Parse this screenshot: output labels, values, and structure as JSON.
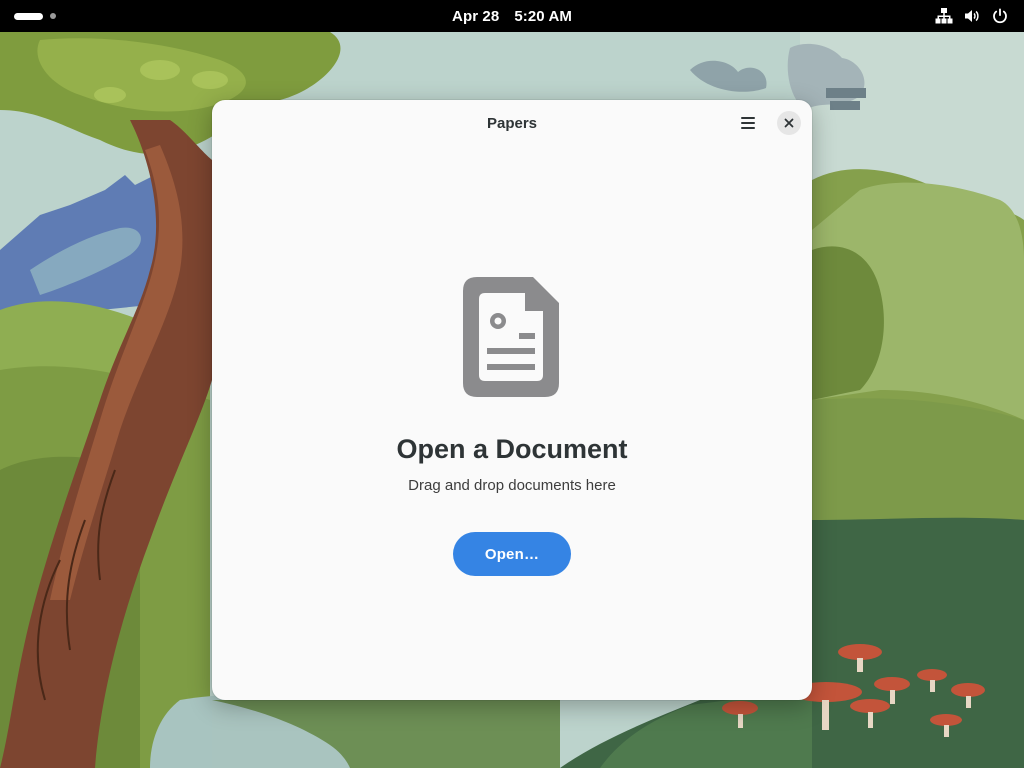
{
  "topbar": {
    "date": "Apr 28",
    "time": "5:20 AM",
    "icons": [
      "network-wired-icon",
      "volume-icon",
      "power-icon"
    ]
  },
  "window": {
    "title": "Papers",
    "menu_icon": "hamburger-menu-icon",
    "close_icon": "close-icon"
  },
  "status_page": {
    "icon": "document-icon",
    "title": "Open a Document",
    "description": "Drag and drop documents here",
    "open_button_label": "Open…"
  },
  "colors": {
    "accent": "#3584e4",
    "window_bg": "#fafafa",
    "topbar_bg": "#000000",
    "icon_gray": "#8b8b8b"
  }
}
